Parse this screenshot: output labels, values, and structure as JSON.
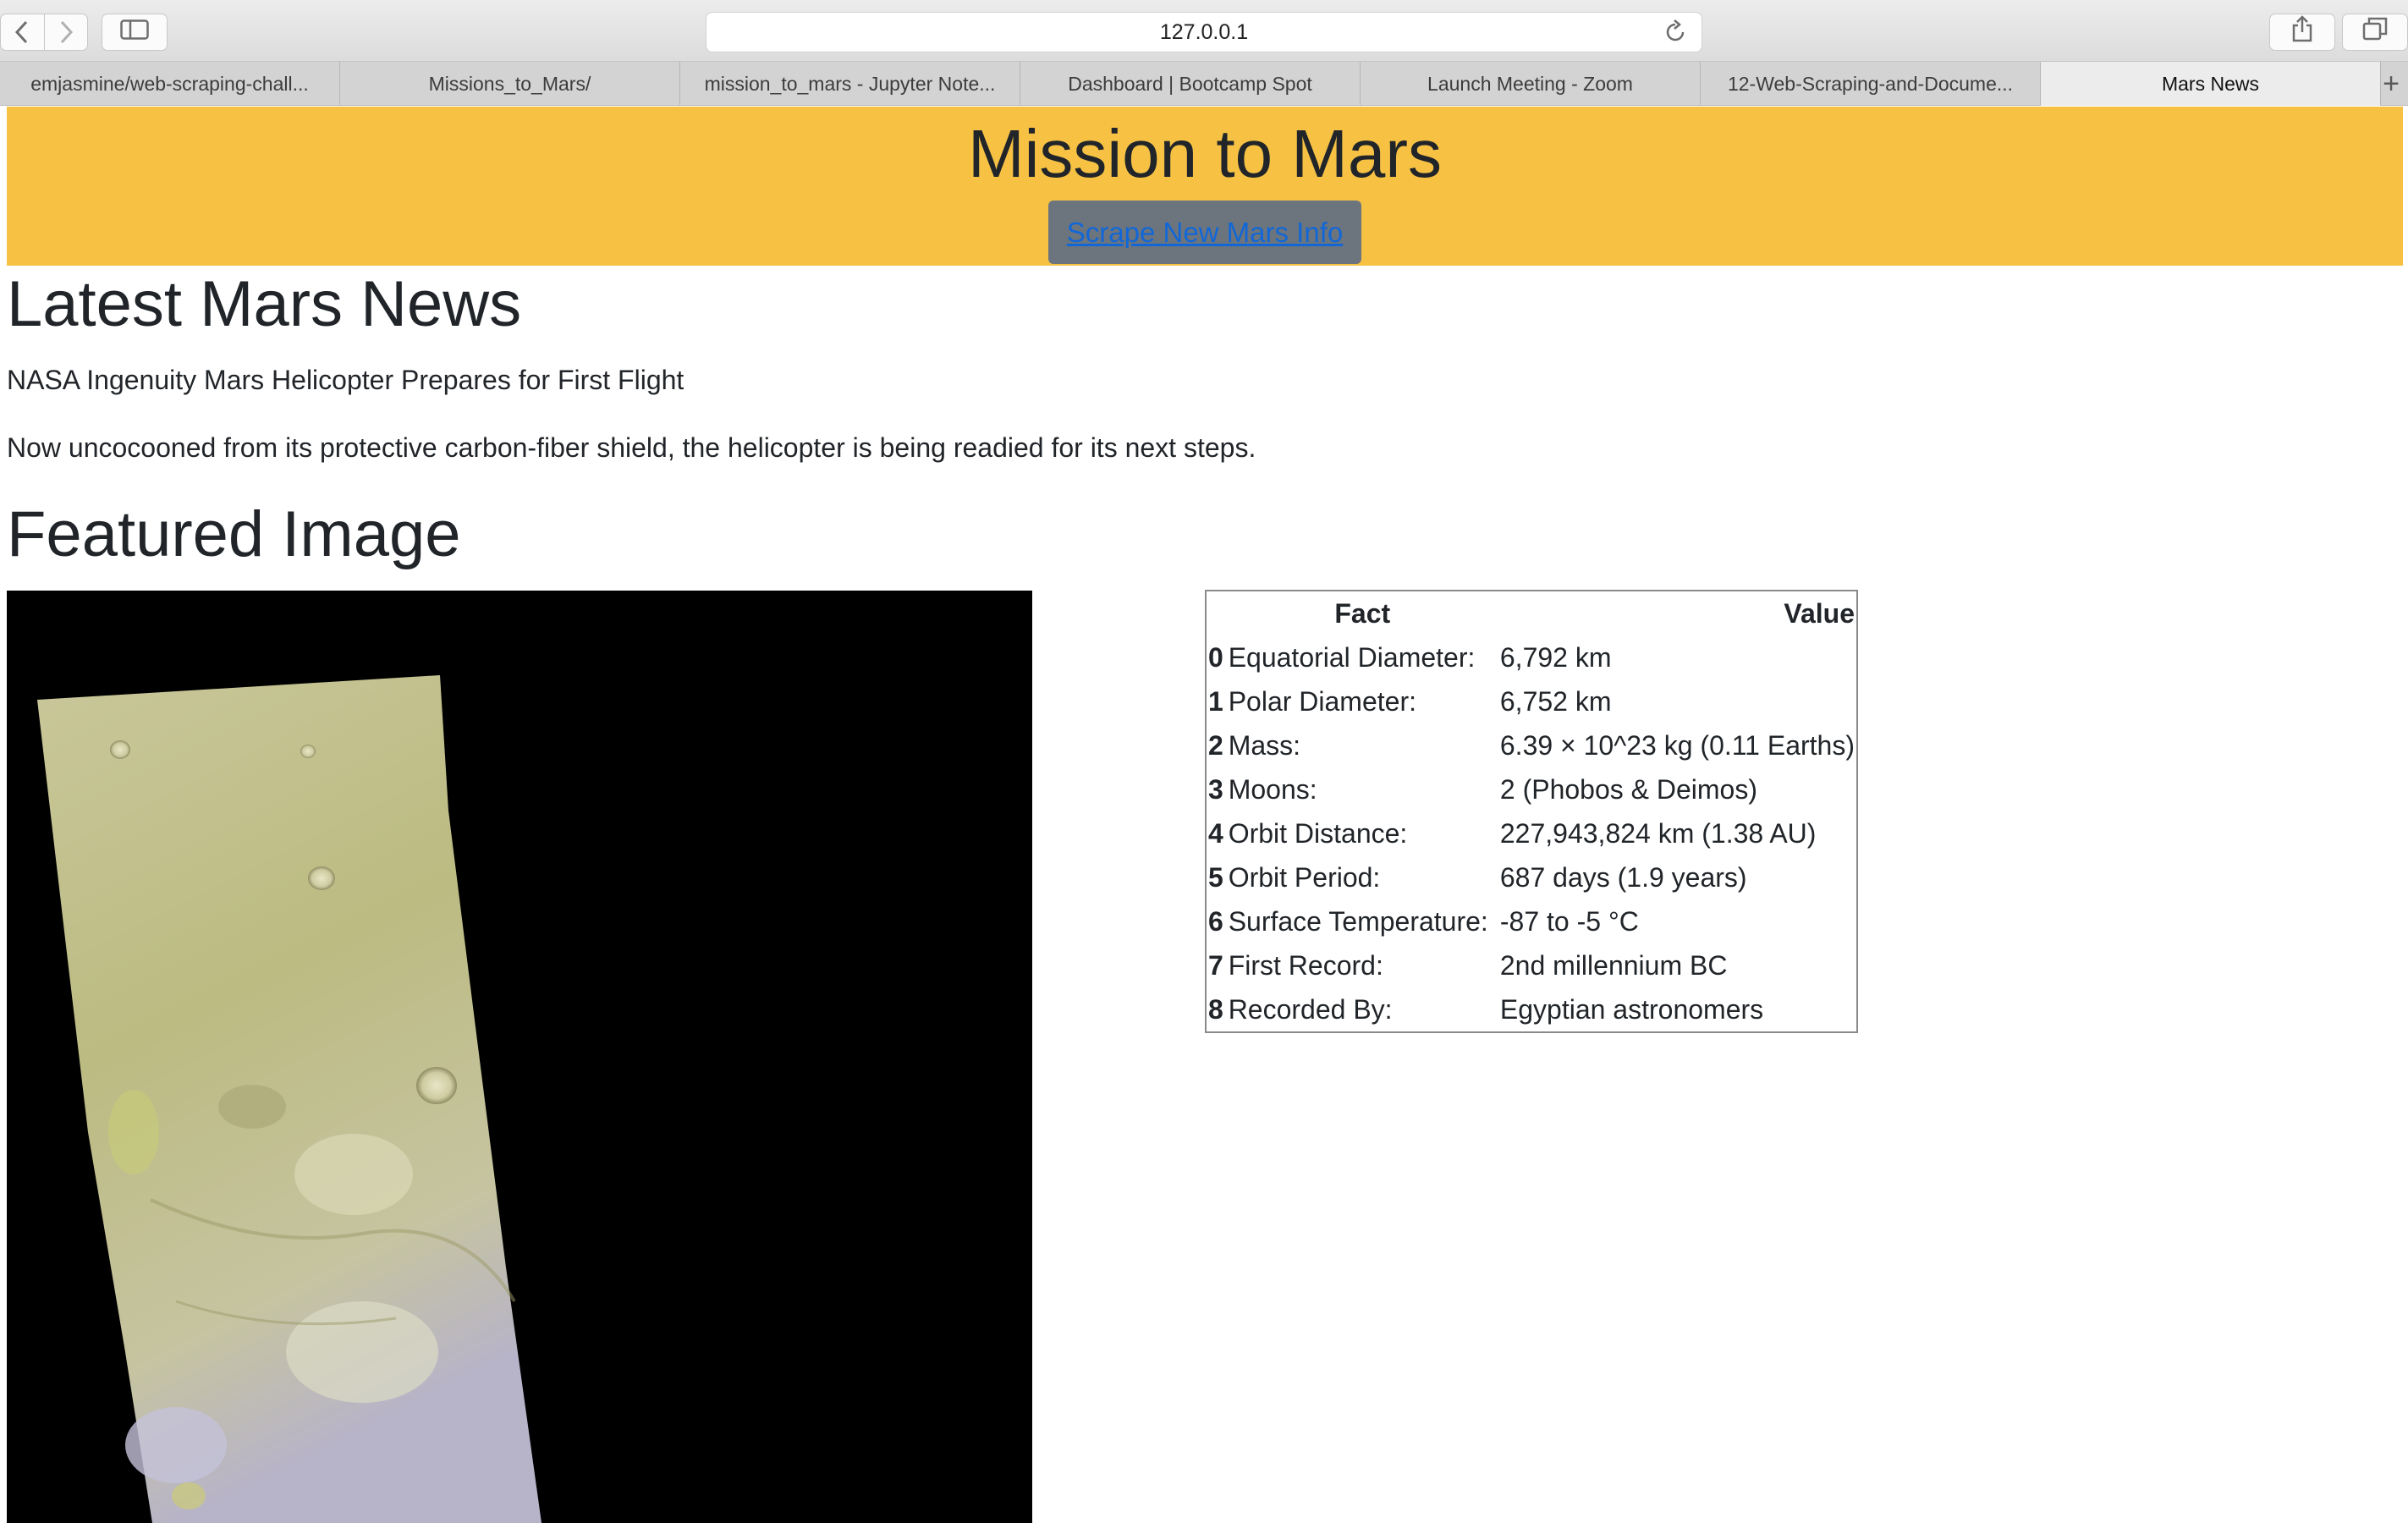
{
  "browser": {
    "address": "127.0.0.1",
    "tabs": [
      {
        "label": "emjasmine/web-scraping-chall..."
      },
      {
        "label": "Missions_to_Mars/"
      },
      {
        "label": "mission_to_mars - Jupyter Note..."
      },
      {
        "label": "Dashboard | Bootcamp Spot"
      },
      {
        "label": "Launch Meeting - Zoom"
      },
      {
        "label": "12-Web-Scraping-and-Docume..."
      },
      {
        "label": "Mars News"
      }
    ],
    "active_tab": 6,
    "icons": [
      "back-icon",
      "forward-icon",
      "sidebar-icon",
      "reload-icon",
      "share-icon",
      "tabs-overview-icon",
      "plus-icon"
    ]
  },
  "jumbotron": {
    "title": "Mission to Mars",
    "button_label": "Scrape New Mars Info",
    "background": "#f7c244"
  },
  "news": {
    "heading": "Latest Mars News",
    "title": "NASA Ingenuity Mars Helicopter Prepares for First Flight",
    "teaser": "Now uncocooned from its protective carbon-fiber shield, the helicopter is being readied for its next steps."
  },
  "featured": {
    "heading": "Featured Image"
  },
  "facts": {
    "header_fact": "Fact",
    "header_value": "Value",
    "rows": [
      {
        "index": "0",
        "fact": "Equatorial Diameter:",
        "value": "6,792 km"
      },
      {
        "index": "1",
        "fact": "Polar Diameter:",
        "value": "6,752 km"
      },
      {
        "index": "2",
        "fact": "Mass:",
        "value": "6.39 × 10^23 kg (0.11 Earths)"
      },
      {
        "index": "3",
        "fact": "Moons:",
        "value": "2 (Phobos & Deimos)"
      },
      {
        "index": "4",
        "fact": "Orbit Distance:",
        "value": "227,943,824 km (1.38 AU)"
      },
      {
        "index": "5",
        "fact": "Orbit Period:",
        "value": "687 days (1.9 years)"
      },
      {
        "index": "6",
        "fact": "Surface Temperature:",
        "value": "-87 to -5 °C"
      },
      {
        "index": "7",
        "fact": "First Record:",
        "value": "2nd millennium BC"
      },
      {
        "index": "8",
        "fact": "Recorded By:",
        "value": "Egyptian astronomers"
      }
    ]
  }
}
